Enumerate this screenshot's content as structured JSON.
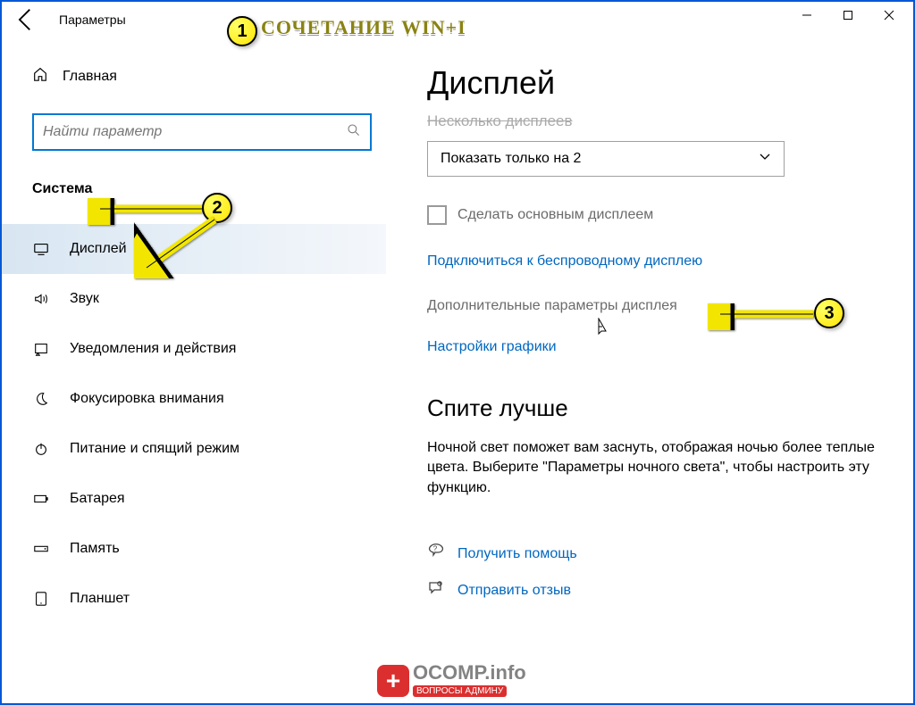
{
  "titlebar": {
    "title": "Параметры"
  },
  "annotation": {
    "hint": "СОЧЕТАНИЕ  WIN+I",
    "badge1": "1",
    "badge2": "2",
    "badge3": "3"
  },
  "sidebar": {
    "home": "Главная",
    "search_placeholder": "Найти параметр",
    "section": "Система",
    "items": [
      {
        "label": "Дисплей"
      },
      {
        "label": "Звук"
      },
      {
        "label": "Уведомления и действия"
      },
      {
        "label": "Фокусировка внимания"
      },
      {
        "label": "Питание и спящий режим"
      },
      {
        "label": "Батарея"
      },
      {
        "label": "Память"
      },
      {
        "label": "Планшет"
      }
    ]
  },
  "main": {
    "h1": "Дисплей",
    "section_crossed": "Несколько дисплеев",
    "dropdown_value": "Показать только на 2",
    "checkbox_label": "Сделать основным дисплеем",
    "link_wireless": "Подключиться к беспроводному дисплею",
    "link_advanced": "Дополнительные параметры дисплея",
    "link_graphics": "Настройки графики",
    "h2_sleep": "Спите лучше",
    "sleep_para": "Ночной свет поможет вам заснуть, отображая ночью более теплые цвета. Выберите \"Параметры ночного света\", чтобы настроить эту функцию.",
    "get_help": "Получить помощь",
    "feedback": "Отправить отзыв"
  },
  "watermark": {
    "brand": "OCOMP.info",
    "sub": "ВОПРОСЫ АДМИНУ"
  }
}
